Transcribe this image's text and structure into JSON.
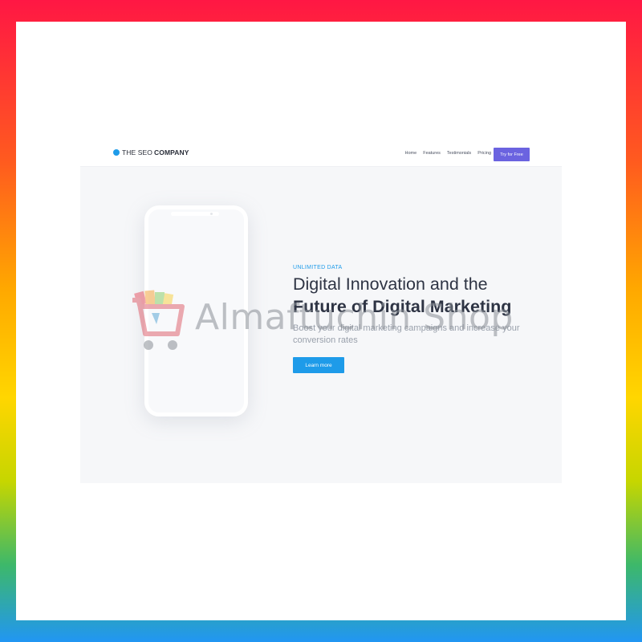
{
  "brand": {
    "name_light": "THE SEO",
    "name_bold": "COMPANY",
    "dot_color": "#1e9be9"
  },
  "nav": {
    "links": [
      "Home",
      "Features",
      "Testimonials",
      "Pricing"
    ],
    "cta_label": "Try for Free",
    "cta_color": "#6b63e0"
  },
  "hero": {
    "eyebrow": "UNLIMITED DATA",
    "headline_light": "Digital Innovation and the",
    "headline_bold": "Future of Digital Marketing",
    "subtext": "Boost your digital marketing campaigns and increase your conversion rates",
    "button_label": "Learn more",
    "button_color": "#1e9be9"
  },
  "watermark": {
    "text": "Almaftuchin Shop"
  }
}
